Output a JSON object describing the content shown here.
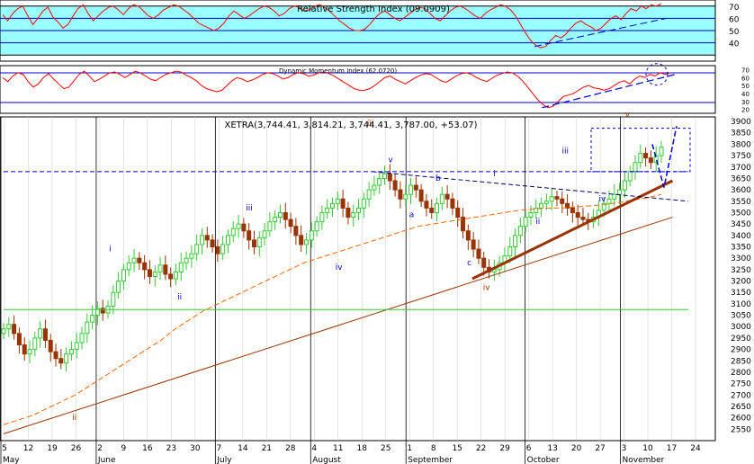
{
  "chart_data": [
    {
      "type": "line",
      "title": "Relative Strength Index (09.0909)",
      "ylim": [
        30,
        70
      ],
      "yticks": [
        "70",
        "60",
        "50",
        "40"
      ],
      "levels": [
        30,
        70
      ],
      "values": [
        63,
        58,
        64,
        68,
        70,
        62,
        55,
        60,
        66,
        69,
        61,
        57,
        52,
        55,
        62,
        68,
        71,
        64,
        58,
        62,
        66,
        69,
        70,
        67,
        63,
        68,
        71,
        70,
        66,
        62,
        60,
        63,
        67,
        69,
        71,
        70,
        67,
        64,
        60,
        56,
        54,
        52,
        50,
        52,
        56,
        62,
        66,
        63,
        60,
        62,
        65,
        68,
        70,
        69,
        66,
        62,
        64,
        68,
        70,
        69,
        66,
        67,
        70,
        71,
        69,
        66,
        62,
        58,
        55,
        52,
        50,
        50,
        51,
        55,
        60,
        64,
        66,
        63,
        60,
        58,
        61,
        64,
        67,
        69,
        68,
        64,
        60,
        58,
        62,
        66,
        69,
        70,
        68,
        65,
        62,
        60,
        64,
        67,
        69,
        71,
        70,
        67,
        62,
        55,
        48,
        42,
        38,
        36,
        37,
        42,
        46,
        44,
        47,
        52,
        56,
        58,
        55,
        53,
        50,
        52,
        56,
        60,
        62,
        59,
        64,
        68,
        66,
        70,
        68,
        71,
        70,
        72
      ],
      "trendline": {
        "from": [
          105,
          37
        ],
        "to": [
          131,
          60
        ],
        "color": "#0000cc",
        "style": "dashed"
      }
    },
    {
      "type": "line",
      "title": "Dynamic Momentum Index (62.0720)",
      "ylim": [
        20,
        70
      ],
      "yticks": [
        "70",
        "60",
        "50",
        "40",
        "30",
        "20"
      ],
      "values": [
        60,
        55,
        62,
        66,
        64,
        55,
        48,
        52,
        60,
        65,
        58,
        52,
        46,
        48,
        56,
        64,
        68,
        62,
        55,
        58,
        62,
        66,
        67,
        64,
        60,
        64,
        68,
        66,
        62,
        58,
        56,
        60,
        64,
        66,
        68,
        67,
        63,
        60,
        56,
        50,
        46,
        44,
        42,
        44,
        50,
        56,
        60,
        58,
        55,
        57,
        60,
        64,
        66,
        65,
        62,
        58,
        60,
        64,
        66,
        65,
        62,
        63,
        66,
        67,
        65,
        62,
        58,
        54,
        50,
        46,
        44,
        44,
        46,
        50,
        55,
        60,
        62,
        58,
        55,
        52,
        56,
        60,
        63,
        65,
        64,
        60,
        56,
        54,
        58,
        62,
        65,
        66,
        64,
        60,
        57,
        55,
        59,
        63,
        65,
        67,
        66,
        62,
        56,
        48,
        40,
        32,
        26,
        22,
        24,
        30,
        36,
        38,
        40,
        44,
        48,
        50,
        47,
        46,
        44,
        46,
        50,
        54,
        56,
        52,
        58,
        62,
        60,
        64,
        62,
        66,
        64,
        66
      ],
      "trendline": {
        "from": [
          105,
          22
        ],
        "to": [
          131,
          64
        ],
        "color": "#0000cc",
        "style": "dashed"
      }
    },
    {
      "type": "candlestick",
      "title": "XETRA(3,744.41, 3,814.21, 3,744.41, 3,787.00, +53.07)",
      "ylim": [
        2500,
        3900
      ],
      "yticks": [
        "3900",
        "3850",
        "3800",
        "3750",
        "3700",
        "3650",
        "3600",
        "3550",
        "3500",
        "3450",
        "3400",
        "3350",
        "3300",
        "3250",
        "3200",
        "3150",
        "3100",
        "3050",
        "3000",
        "2950",
        "2900",
        "2850",
        "2800",
        "2750",
        "2700",
        "2650",
        "2600",
        "2550"
      ],
      "xticks": [
        "5",
        "12",
        "19",
        "26",
        "2",
        "9",
        "16",
        "23",
        "30",
        "7",
        "14",
        "21",
        "28",
        "4",
        "11",
        "18",
        "25",
        "1",
        "8",
        "15",
        "22",
        "29",
        "6",
        "13",
        "20",
        "27",
        "3",
        "10",
        "17",
        "24"
      ],
      "months": [
        "May",
        "June",
        "July",
        "August",
        "September",
        "October",
        "November"
      ],
      "close": [
        2990,
        3010,
        2970,
        2920,
        2880,
        2900,
        2950,
        2990,
        2940,
        2890,
        2860,
        2840,
        2880,
        2900,
        2930,
        2970,
        3020,
        3050,
        3080,
        3060,
        3090,
        3150,
        3200,
        3250,
        3280,
        3300,
        3280,
        3250,
        3220,
        3240,
        3270,
        3230,
        3210,
        3240,
        3280,
        3300,
        3320,
        3360,
        3400,
        3380,
        3350,
        3320,
        3360,
        3400,
        3430,
        3450,
        3420,
        3380,
        3350,
        3390,
        3420,
        3460,
        3480,
        3500,
        3470,
        3440,
        3400,
        3360,
        3380,
        3420,
        3460,
        3500,
        3520,
        3540,
        3560,
        3520,
        3480,
        3500,
        3520,
        3560,
        3600,
        3620,
        3650,
        3670,
        3640,
        3600,
        3560,
        3580,
        3620,
        3600,
        3550,
        3520,
        3500,
        3540,
        3580,
        3560,
        3520,
        3480,
        3420,
        3380,
        3340,
        3300,
        3260,
        3240,
        3250,
        3280,
        3310,
        3350,
        3400,
        3440,
        3480,
        3500,
        3520,
        3540,
        3550,
        3570,
        3560,
        3540,
        3520,
        3500,
        3480,
        3470,
        3460,
        3480,
        3510,
        3540,
        3560,
        3580,
        3600,
        3640,
        3680,
        3720,
        3760,
        3740,
        3720,
        3750,
        3787
      ],
      "ma": [
        2570,
        2590,
        2610,
        2640,
        2670,
        2700,
        2740,
        2780,
        2820,
        2860,
        2900,
        2940,
        2990,
        3030,
        3070,
        3100,
        3130,
        3160,
        3190,
        3220,
        3250,
        3280,
        3300,
        3320,
        3340,
        3360,
        3380,
        3400,
        3420,
        3440,
        3450,
        3460,
        3470,
        3480,
        3490,
        3500,
        3510,
        3515,
        3520,
        3520,
        3525,
        3530,
        3535,
        3545,
        3555,
        3565,
        3580
      ],
      "trendlines": [
        {
          "from": [
            0,
            2530
          ],
          "to": [
            127,
            3480
          ],
          "color": "#993300",
          "style": "solid"
        },
        {
          "from": [
            89,
            3210
          ],
          "to": [
            127,
            3640
          ],
          "color": "#993300",
          "style": "solid-thick"
        },
        {
          "from": [
            0,
            3075
          ],
          "to": [
            130,
            3075
          ],
          "color": "#33cc33",
          "style": "solid"
        },
        {
          "from": [
            0,
            3680
          ],
          "to": [
            130,
            3680
          ],
          "color": "#0000cc",
          "style": "dashed"
        },
        {
          "from": [
            70,
            3680
          ],
          "to": [
            130,
            3550
          ],
          "color": "#000066",
          "style": "dashed"
        }
      ],
      "annotations": [
        {
          "label": "i",
          "x": 20,
          "y": 3330,
          "color": "#0000cc"
        },
        {
          "label": "ii",
          "x": 33,
          "y": 3120,
          "color": "#0000cc"
        },
        {
          "label": "iii",
          "x": 46,
          "y": 3510,
          "color": "#0000cc"
        },
        {
          "label": "iv",
          "x": 63,
          "y": 3250,
          "color": "#0000cc"
        },
        {
          "label": "v",
          "x": 73,
          "y": 3720,
          "color": "#0000cc"
        },
        {
          "label": "a",
          "x": 77,
          "y": 3480,
          "color": "#0000cc"
        },
        {
          "label": "b",
          "x": 82,
          "y": 3640,
          "color": "#0000cc"
        },
        {
          "label": "c",
          "x": 88,
          "y": 3270,
          "color": "#0000cc"
        },
        {
          "label": "i",
          "x": 93,
          "y": 3660,
          "color": "#0000cc"
        },
        {
          "label": "ii",
          "x": 101,
          "y": 3450,
          "color": "#0000cc"
        },
        {
          "label": "iii",
          "x": 106,
          "y": 3760,
          "color": "#0000cc"
        },
        {
          "label": "iv",
          "x": 113,
          "y": 3550,
          "color": "#0000cc"
        },
        {
          "label": "ii",
          "x": 13,
          "y": 2590,
          "color": "#993300"
        },
        {
          "label": "iii",
          "x": 69,
          "y": 3880,
          "color": "#993300"
        },
        {
          "label": "iv",
          "x": 91,
          "y": 3160,
          "color": "#993300"
        },
        {
          "label": "v",
          "x": 118,
          "y": 3920,
          "color": "#993300"
        }
      ]
    }
  ],
  "colors": {
    "rsi_band": "#99ffff",
    "rsi_line": "#ff0000",
    "price_up": "#33cc33",
    "price_down": "#993300",
    "ma": "#ff6600",
    "trend": "#993300",
    "support": "#33cc33",
    "wave_blue": "#0000cc"
  }
}
